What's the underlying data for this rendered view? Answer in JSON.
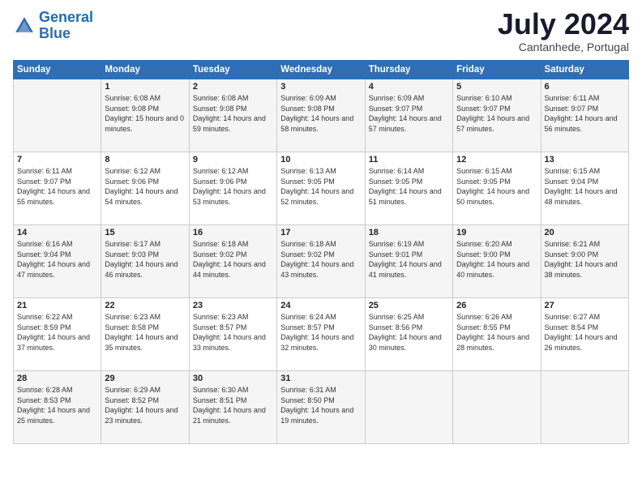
{
  "logo": {
    "line1": "General",
    "line2": "Blue"
  },
  "title": "July 2024",
  "location": "Cantanhede, Portugal",
  "weekdays": [
    "Sunday",
    "Monday",
    "Tuesday",
    "Wednesday",
    "Thursday",
    "Friday",
    "Saturday"
  ],
  "weeks": [
    [
      {
        "day": "",
        "sunrise": "",
        "sunset": "",
        "daylight": ""
      },
      {
        "day": "1",
        "sunrise": "Sunrise: 6:08 AM",
        "sunset": "Sunset: 9:08 PM",
        "daylight": "Daylight: 15 hours and 0 minutes."
      },
      {
        "day": "2",
        "sunrise": "Sunrise: 6:08 AM",
        "sunset": "Sunset: 9:08 PM",
        "daylight": "Daylight: 14 hours and 59 minutes."
      },
      {
        "day": "3",
        "sunrise": "Sunrise: 6:09 AM",
        "sunset": "Sunset: 9:08 PM",
        "daylight": "Daylight: 14 hours and 58 minutes."
      },
      {
        "day": "4",
        "sunrise": "Sunrise: 6:09 AM",
        "sunset": "Sunset: 9:07 PM",
        "daylight": "Daylight: 14 hours and 57 minutes."
      },
      {
        "day": "5",
        "sunrise": "Sunrise: 6:10 AM",
        "sunset": "Sunset: 9:07 PM",
        "daylight": "Daylight: 14 hours and 57 minutes."
      },
      {
        "day": "6",
        "sunrise": "Sunrise: 6:11 AM",
        "sunset": "Sunset: 9:07 PM",
        "daylight": "Daylight: 14 hours and 56 minutes."
      }
    ],
    [
      {
        "day": "7",
        "sunrise": "Sunrise: 6:11 AM",
        "sunset": "Sunset: 9:07 PM",
        "daylight": "Daylight: 14 hours and 55 minutes."
      },
      {
        "day": "8",
        "sunrise": "Sunrise: 6:12 AM",
        "sunset": "Sunset: 9:06 PM",
        "daylight": "Daylight: 14 hours and 54 minutes."
      },
      {
        "day": "9",
        "sunrise": "Sunrise: 6:12 AM",
        "sunset": "Sunset: 9:06 PM",
        "daylight": "Daylight: 14 hours and 53 minutes."
      },
      {
        "day": "10",
        "sunrise": "Sunrise: 6:13 AM",
        "sunset": "Sunset: 9:05 PM",
        "daylight": "Daylight: 14 hours and 52 minutes."
      },
      {
        "day": "11",
        "sunrise": "Sunrise: 6:14 AM",
        "sunset": "Sunset: 9:05 PM",
        "daylight": "Daylight: 14 hours and 51 minutes."
      },
      {
        "day": "12",
        "sunrise": "Sunrise: 6:15 AM",
        "sunset": "Sunset: 9:05 PM",
        "daylight": "Daylight: 14 hours and 50 minutes."
      },
      {
        "day": "13",
        "sunrise": "Sunrise: 6:15 AM",
        "sunset": "Sunset: 9:04 PM",
        "daylight": "Daylight: 14 hours and 48 minutes."
      }
    ],
    [
      {
        "day": "14",
        "sunrise": "Sunrise: 6:16 AM",
        "sunset": "Sunset: 9:04 PM",
        "daylight": "Daylight: 14 hours and 47 minutes."
      },
      {
        "day": "15",
        "sunrise": "Sunrise: 6:17 AM",
        "sunset": "Sunset: 9:03 PM",
        "daylight": "Daylight: 14 hours and 46 minutes."
      },
      {
        "day": "16",
        "sunrise": "Sunrise: 6:18 AM",
        "sunset": "Sunset: 9:02 PM",
        "daylight": "Daylight: 14 hours and 44 minutes."
      },
      {
        "day": "17",
        "sunrise": "Sunrise: 6:18 AM",
        "sunset": "Sunset: 9:02 PM",
        "daylight": "Daylight: 14 hours and 43 minutes."
      },
      {
        "day": "18",
        "sunrise": "Sunrise: 6:19 AM",
        "sunset": "Sunset: 9:01 PM",
        "daylight": "Daylight: 14 hours and 41 minutes."
      },
      {
        "day": "19",
        "sunrise": "Sunrise: 6:20 AM",
        "sunset": "Sunset: 9:00 PM",
        "daylight": "Daylight: 14 hours and 40 minutes."
      },
      {
        "day": "20",
        "sunrise": "Sunrise: 6:21 AM",
        "sunset": "Sunset: 9:00 PM",
        "daylight": "Daylight: 14 hours and 38 minutes."
      }
    ],
    [
      {
        "day": "21",
        "sunrise": "Sunrise: 6:22 AM",
        "sunset": "Sunset: 8:59 PM",
        "daylight": "Daylight: 14 hours and 37 minutes."
      },
      {
        "day": "22",
        "sunrise": "Sunrise: 6:23 AM",
        "sunset": "Sunset: 8:58 PM",
        "daylight": "Daylight: 14 hours and 35 minutes."
      },
      {
        "day": "23",
        "sunrise": "Sunrise: 6:23 AM",
        "sunset": "Sunset: 8:57 PM",
        "daylight": "Daylight: 14 hours and 33 minutes."
      },
      {
        "day": "24",
        "sunrise": "Sunrise: 6:24 AM",
        "sunset": "Sunset: 8:57 PM",
        "daylight": "Daylight: 14 hours and 32 minutes."
      },
      {
        "day": "25",
        "sunrise": "Sunrise: 6:25 AM",
        "sunset": "Sunset: 8:56 PM",
        "daylight": "Daylight: 14 hours and 30 minutes."
      },
      {
        "day": "26",
        "sunrise": "Sunrise: 6:26 AM",
        "sunset": "Sunset: 8:55 PM",
        "daylight": "Daylight: 14 hours and 28 minutes."
      },
      {
        "day": "27",
        "sunrise": "Sunrise: 6:27 AM",
        "sunset": "Sunset: 8:54 PM",
        "daylight": "Daylight: 14 hours and 26 minutes."
      }
    ],
    [
      {
        "day": "28",
        "sunrise": "Sunrise: 6:28 AM",
        "sunset": "Sunset: 8:53 PM",
        "daylight": "Daylight: 14 hours and 25 minutes."
      },
      {
        "day": "29",
        "sunrise": "Sunrise: 6:29 AM",
        "sunset": "Sunset: 8:52 PM",
        "daylight": "Daylight: 14 hours and 23 minutes."
      },
      {
        "day": "30",
        "sunrise": "Sunrise: 6:30 AM",
        "sunset": "Sunset: 8:51 PM",
        "daylight": "Daylight: 14 hours and 21 minutes."
      },
      {
        "day": "31",
        "sunrise": "Sunrise: 6:31 AM",
        "sunset": "Sunset: 8:50 PM",
        "daylight": "Daylight: 14 hours and 19 minutes."
      },
      {
        "day": "",
        "sunrise": "",
        "sunset": "",
        "daylight": ""
      },
      {
        "day": "",
        "sunrise": "",
        "sunset": "",
        "daylight": ""
      },
      {
        "day": "",
        "sunrise": "",
        "sunset": "",
        "daylight": ""
      }
    ]
  ]
}
